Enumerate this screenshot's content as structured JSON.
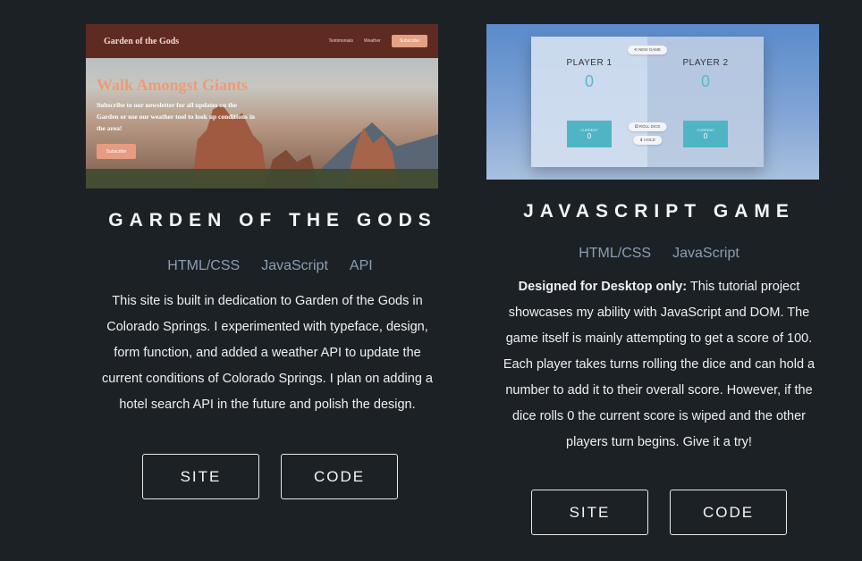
{
  "projects": [
    {
      "title": "GARDEN OF THE GODS",
      "preview": {
        "brand": "Garden of the Gods",
        "nav_links": [
          "Testimonials",
          "Weather"
        ],
        "nav_button": "Subscribe",
        "headline": "Walk Amongst Giants",
        "body": "Subscribe to our newsletter for all updates on the Garden or use our weather tool to look up conditions in the area!",
        "cta": "Subscribe"
      },
      "tags": [
        "HTML/CSS",
        "JavaScript",
        "API"
      ],
      "description_lines": [
        "This site is built in dedication to Garden of the Gods in",
        "Colorado Springs. I experimented with typeface, design,",
        "form function, and added a weather API to update the",
        "current conditions of Colorado Springs. I plan on adding a",
        "hotel search API in the future and polish the design."
      ],
      "buttons": {
        "site": "SITE",
        "code": "CODE"
      }
    },
    {
      "title": "JAVASCRIPT GAME",
      "preview": {
        "new_game": "NEW GAME",
        "player1": "PLAYER 1",
        "player2": "PLAYER 2",
        "score1": "0",
        "score2": "0",
        "current_label": "CURRENT",
        "current1": "0",
        "current2": "0",
        "roll": "ROLL DICE",
        "hold": "HOLD"
      },
      "tags": [
        "HTML/CSS",
        "JavaScript"
      ],
      "description_bold": "Designed for Desktop only:",
      "description_first": " This tutorial project",
      "description_lines": [
        "showcases my ability with JavaScript and DOM. The",
        "game itself is mainly attempting to get a score of 100.",
        "Each player takes turns rolling the dice and can hold a",
        "number to add it to their overall score. However, if the",
        "dice rolls 0 the current score is wiped and the other",
        "players turn begins. Give it a try!"
      ],
      "buttons": {
        "site": "SITE",
        "code": "CODE"
      }
    }
  ]
}
